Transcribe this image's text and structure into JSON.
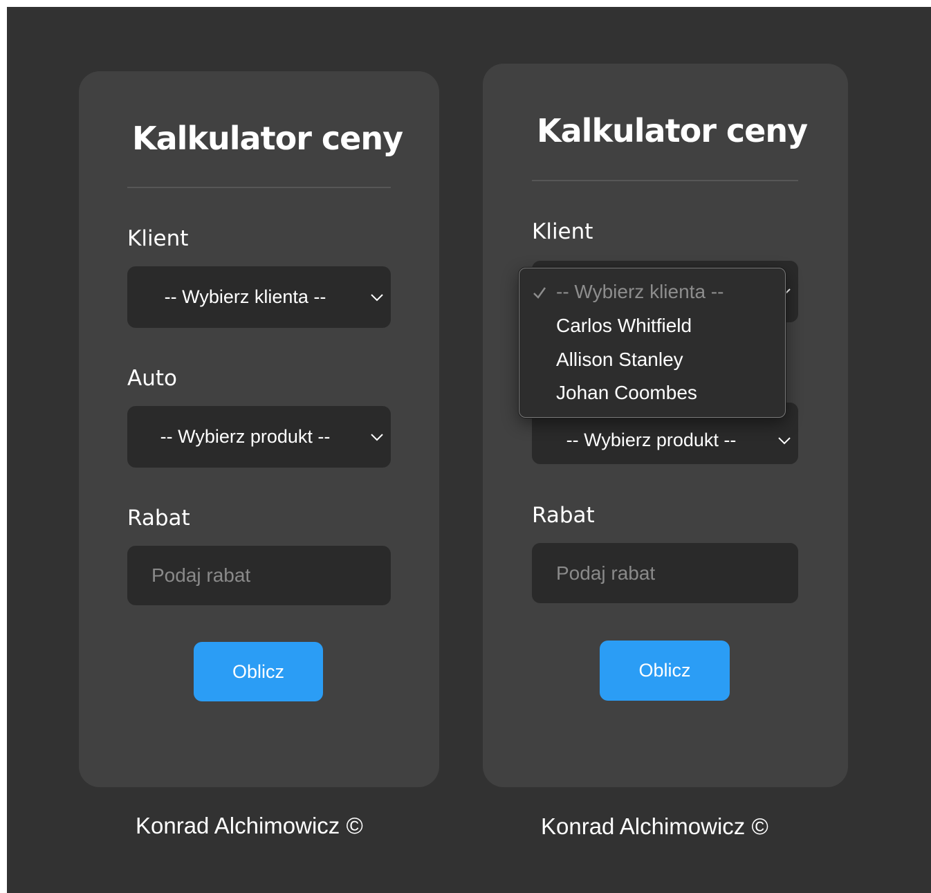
{
  "left_form": {
    "title": "Kalkulator ceny",
    "client_label": "Klient",
    "client_select_value": "-- Wybierz klienta --",
    "car_label": "Auto",
    "car_select_value": "-- Wybierz produkt --",
    "discount_label": "Rabat",
    "discount_placeholder": "Podaj rabat",
    "submit_label": "Oblicz",
    "footer": "Konrad Alchimowicz ©"
  },
  "right_form": {
    "title": "Kalkulator ceny",
    "client_label": "Klient",
    "car_select_value": "-- Wybierz produkt --",
    "discount_label": "Rabat",
    "discount_placeholder": "Podaj rabat",
    "submit_label": "Oblicz",
    "footer": "Konrad Alchimowicz ©",
    "client_dropdown": {
      "options": [
        {
          "label": "-- Wybierz klienta --",
          "selected": true
        },
        {
          "label": "Carlos Whitfield",
          "selected": false
        },
        {
          "label": "Allison Stanley",
          "selected": false
        },
        {
          "label": "Johan Coombes",
          "selected": false
        }
      ]
    }
  },
  "colors": {
    "page_background": "#323232",
    "card_background": "#414141",
    "field_background": "#2a2a2a",
    "button_accent": "#2b9df5"
  },
  "icons": {
    "select_arrow": "chevron-down-icon",
    "selected_option": "checkmark-icon"
  }
}
